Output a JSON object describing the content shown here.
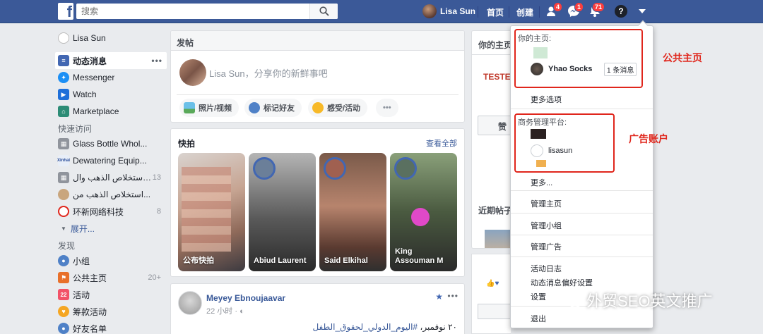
{
  "topbar": {
    "search_placeholder": "搜索",
    "user_name": "Lisa Sun",
    "home": "首页",
    "create": "创建",
    "friend_requests_count": "4",
    "messages_count": "1",
    "notifications_count": "71",
    "help": "?"
  },
  "sidebar": {
    "profile": "Lisa Sun",
    "main": [
      {
        "label": "动态消息",
        "more": "•••",
        "color": "#4267b2"
      },
      {
        "label": "Messenger",
        "color": "#1c8ff5"
      },
      {
        "label": "Watch",
        "color": "#1e6fd9"
      },
      {
        "label": "Marketplace",
        "color": "#2c8c76"
      }
    ],
    "quick_access_title": "快速访问",
    "quick": [
      {
        "label": "Glass Bottle Whol...",
        "count": ""
      },
      {
        "label": "Dewatering Equip...",
        "count": ""
      },
      {
        "label": "استخلاص الذهب وال...",
        "count": "13"
      },
      {
        "label": "استخلاص الذهب من...",
        "count": ""
      },
      {
        "label": "环新网络科技",
        "count": "8"
      }
    ],
    "expand": "展开...",
    "discover_title": "发现",
    "discover": [
      {
        "label": "小组",
        "count": "",
        "color": "#4f81c7"
      },
      {
        "label": "公共主页",
        "count": "20+",
        "color": "#e8702a"
      },
      {
        "label": "活动",
        "count": "",
        "color": "#f25268"
      },
      {
        "label": "筹款活动",
        "count": "",
        "color": "#f5a623"
      },
      {
        "label": "好友名单",
        "count": "",
        "color": "#4f81c7"
      }
    ]
  },
  "composer": {
    "title": "发帖",
    "placeholder": "Lisa Sun，分享你的新鲜事吧",
    "photo": "照片/视频",
    "tag": "标记好友",
    "feeling": "感受/活动",
    "more": "•••"
  },
  "stories": {
    "title": "快拍",
    "see_all": "查看全部",
    "items": [
      {
        "name": "公布快拍"
      },
      {
        "name": "Abiud Laurent"
      },
      {
        "name": "Said Elkihal"
      },
      {
        "name": "King\nAssouman M"
      }
    ]
  },
  "post": {
    "author": "Meyey Ebnoujaavar",
    "time": "22 小时 · ",
    "text_prefix": "٢٠ نوفمبر، ",
    "text_hashtag": "#اليوم_الدولي_لحقوق_الطفل",
    "more": "•••"
  },
  "right_col": {
    "title": "你的主页",
    "recent": "近期帖子",
    "logo_text": "TESTEX",
    "button": "赞"
  },
  "dropdown": {
    "your_pages": "你的主页:",
    "page_name": "Yhao Socks",
    "page_badge": "1 条消息",
    "more_options": "更多选项",
    "business_manager": "商务管理平台:",
    "bm_account": "lisasun",
    "more": "更多...",
    "manage_pages": "管理主页",
    "manage_groups": "管理小组",
    "manage_ads": "管理广告",
    "activity_log": "活动日志",
    "feed_prefs": "动态消息偏好设置",
    "settings": "设置",
    "logout": "退出"
  },
  "annotations": {
    "public_page": "公共主页",
    "ad_account": "广告账户"
  },
  "watermark": "外贸SEO英文推广"
}
